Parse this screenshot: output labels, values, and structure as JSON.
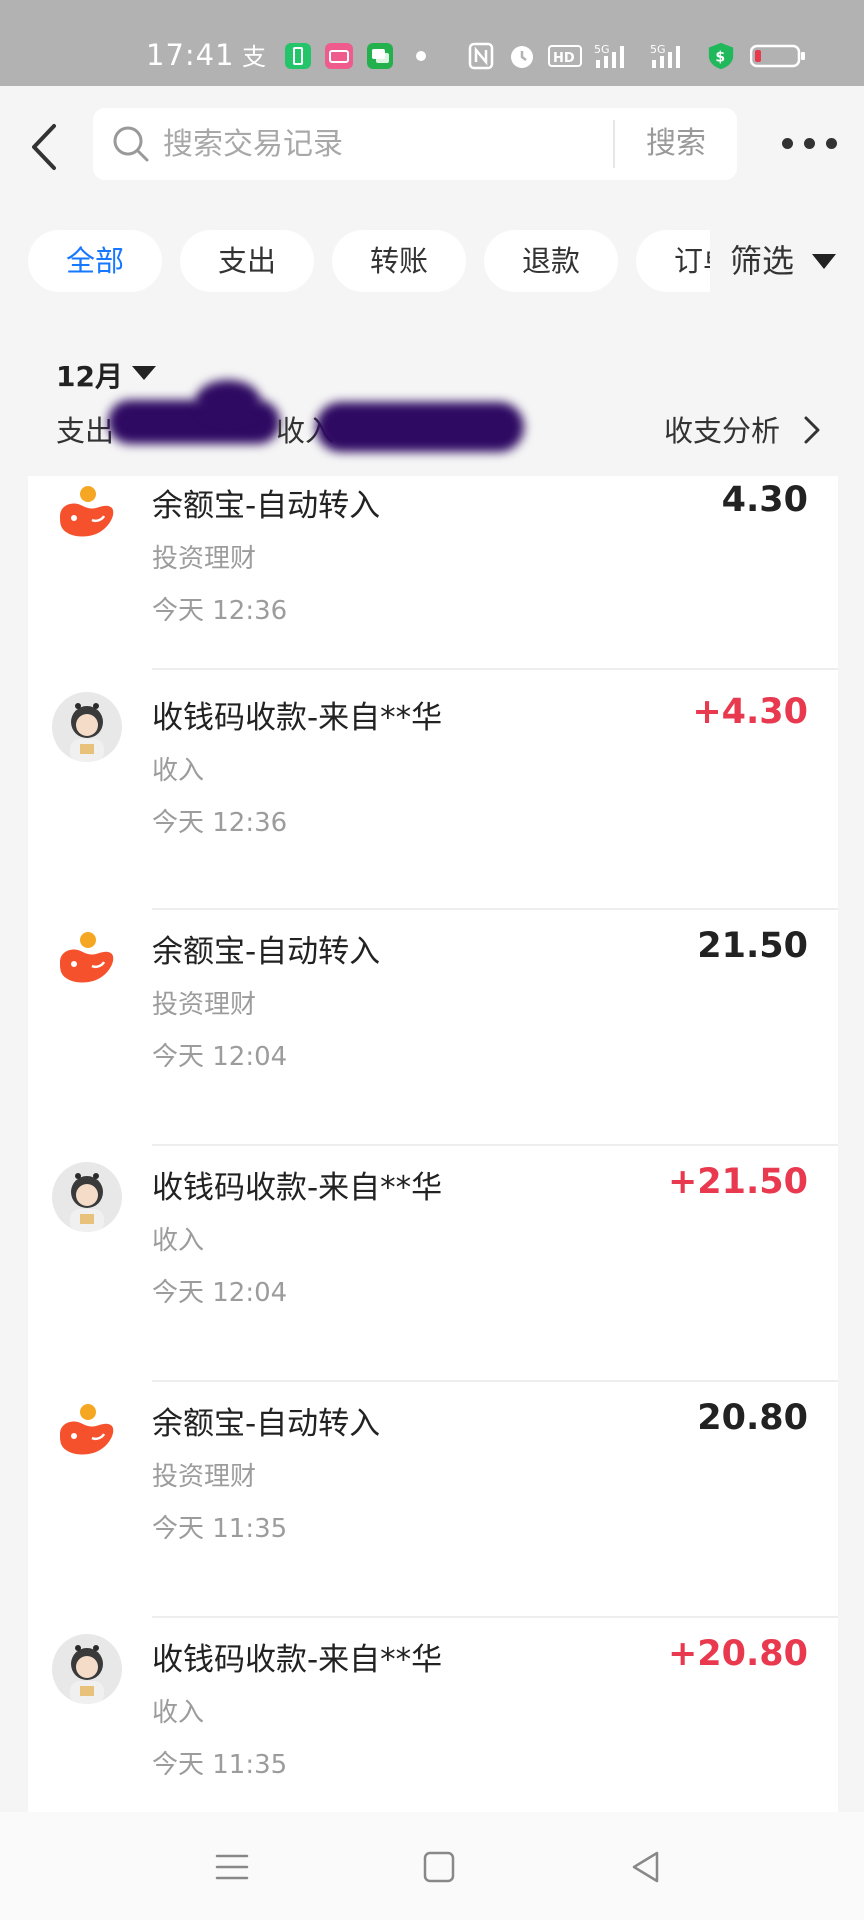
{
  "status_bar": {
    "time": "17:41",
    "icons": [
      "alipay-icon",
      "battery-saver-icon",
      "bilibili-icon",
      "message-icon",
      "dot-icon",
      "nfc-icon",
      "alarm-icon",
      "hd-icon",
      "signal-5g-icon",
      "signal-5g-icon",
      "security-shield-icon",
      "battery-low-icon"
    ]
  },
  "header": {
    "search_placeholder": "搜索交易记录",
    "search_button": "搜索"
  },
  "chips": [
    "全部",
    "支出",
    "转账",
    "退款",
    "订单"
  ],
  "filter_label": "筛选",
  "summary": {
    "month": "12月",
    "expense_label": "支出",
    "income_label": "收入",
    "analysis_label": "收支分析"
  },
  "transactions": [
    {
      "title": "余额宝-自动转入",
      "category": "投资理财",
      "time": "今天 12:36",
      "amount": "4.30",
      "type": "yuebao"
    },
    {
      "title": "收钱码收款-来自**华",
      "category": "收入",
      "time": "今天 12:36",
      "amount": "+4.30",
      "type": "income"
    },
    {
      "title": "余额宝-自动转入",
      "category": "投资理财",
      "time": "今天 12:04",
      "amount": "21.50",
      "type": "yuebao"
    },
    {
      "title": "收钱码收款-来自**华",
      "category": "收入",
      "time": "今天 12:04",
      "amount": "+21.50",
      "type": "income"
    },
    {
      "title": "余额宝-自动转入",
      "category": "投资理财",
      "time": "今天 11:35",
      "amount": "20.80",
      "type": "yuebao"
    },
    {
      "title": "收钱码收款-来自**华",
      "category": "收入",
      "time": "今天 11:35",
      "amount": "+20.80",
      "type": "income"
    }
  ],
  "colors": {
    "accent": "#1677ff",
    "income": "#e8394e",
    "yuebao": "#f5512d",
    "redaction": "#2e0a62"
  }
}
